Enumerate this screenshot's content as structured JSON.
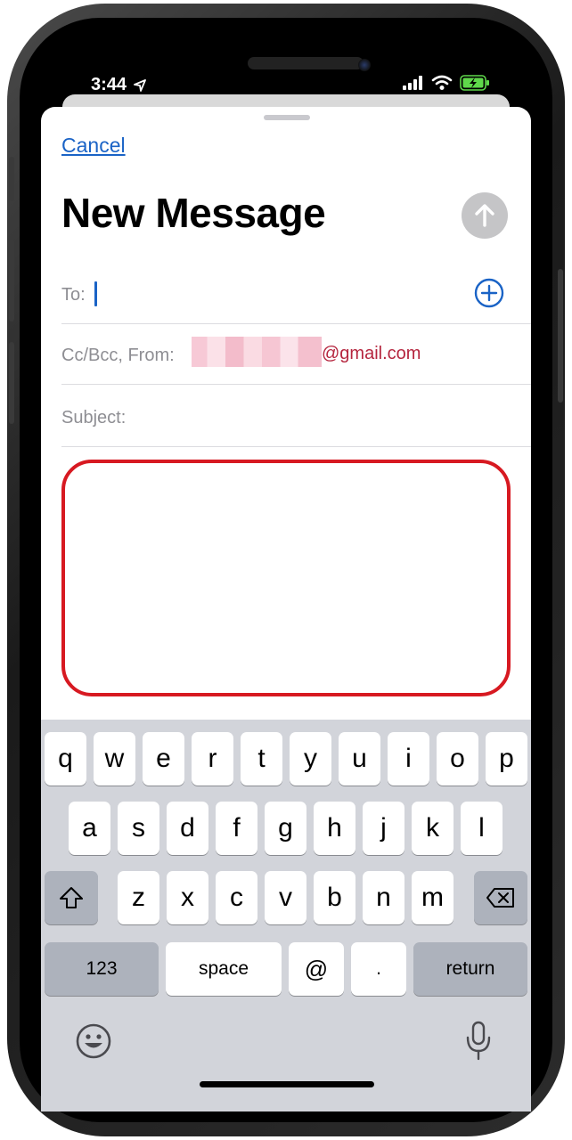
{
  "status": {
    "time": "3:44"
  },
  "header": {
    "cancel_label": "Cancel",
    "title": "New Message"
  },
  "fields": {
    "to_label": "To:",
    "ccbcc_label": "Cc/Bcc, From:",
    "from_email_suffix": "@gmail.com",
    "subject_label": "Subject:"
  },
  "keyboard": {
    "row1": [
      "q",
      "w",
      "e",
      "r",
      "t",
      "y",
      "u",
      "i",
      "o",
      "p"
    ],
    "row2": [
      "a",
      "s",
      "d",
      "f",
      "g",
      "h",
      "j",
      "k",
      "l"
    ],
    "row3": [
      "z",
      "x",
      "c",
      "v",
      "b",
      "n",
      "m"
    ],
    "numbers_label": "123",
    "space_label": "space",
    "at_label": "@",
    "dot_label": ".",
    "return_label": "return"
  },
  "colors": {
    "link": "#1a63c6",
    "highlight": "#d71921",
    "email": "#b5253e",
    "keyboard_bg": "#d2d4da"
  },
  "icons": {
    "send": "arrow-up-icon",
    "add_recipient": "plus-circle-icon",
    "shift": "shift-icon",
    "delete": "backspace-icon",
    "emoji": "emoji-icon",
    "dictation": "microphone-icon",
    "location": "location-arrow-icon",
    "signal": "cellular-signal-icon",
    "wifi": "wifi-icon",
    "battery": "battery-charging-icon"
  }
}
